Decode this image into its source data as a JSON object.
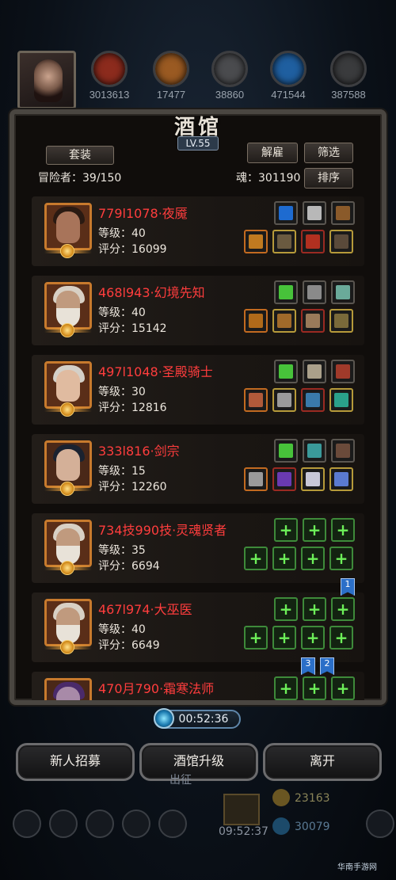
{
  "top_bar": {
    "resources": [
      {
        "value": "3013613",
        "color": "#8c2b1d",
        "icon": "red-orb-icon"
      },
      {
        "value": "17477",
        "color": "#9a5a22",
        "icon": "scroll-orb-icon"
      },
      {
        "value": "38860",
        "color": "#4a4b4e",
        "icon": "ingot-orb-icon"
      },
      {
        "value": "471544",
        "color": "#1f5fa0",
        "icon": "blue-crystal-orb-icon"
      },
      {
        "value": "387588",
        "color": "#3a3b3d",
        "icon": "gray-orb-icon"
      }
    ]
  },
  "panel": {
    "title": "酒馆",
    "level": "LV.55",
    "outfit_button": "套装",
    "dismiss_button": "解雇",
    "filter_button": "筛选",
    "adventurers_label": "冒险者：39/150",
    "soul_label": "魂：301190",
    "sort_button": "排序"
  },
  "heroes": [
    {
      "name": "779l1078·夜魇",
      "level": "等级：40",
      "score": "评分：16099",
      "portrait": "pirate",
      "slots_top": [
        {
          "color": "#1e6bd0",
          "border": "gray"
        },
        {
          "color": "#b8b8b8",
          "border": "gray"
        },
        {
          "color": "#8a5a2a",
          "border": "gray"
        }
      ],
      "slots_bottom": [
        {
          "color": "#c07a20",
          "border": "orange"
        },
        {
          "color": "#6a5a40",
          "border": "gold"
        },
        {
          "color": "#b23020",
          "border": "red"
        },
        {
          "color": "#5a4a3a",
          "border": "gold"
        }
      ]
    },
    {
      "name": "468l943·幻境先知",
      "level": "等级：40",
      "score": "评分：15142",
      "portrait": "sage",
      "slots_top": [
        {
          "color": "#47c23a",
          "border": "gray"
        },
        {
          "color": "#8a8a8a",
          "border": "gray"
        },
        {
          "color": "#6aaa9a",
          "border": "gray"
        }
      ],
      "slots_bottom": [
        {
          "color": "#b06a1a",
          "border": "orange"
        },
        {
          "color": "#a06a2a",
          "border": "gold"
        },
        {
          "color": "#9a7a5a",
          "border": "red"
        },
        {
          "color": "#7a6a3a",
          "border": "gold"
        }
      ]
    },
    {
      "name": "497l1048·圣殿骑士",
      "level": "等级：30",
      "score": "评分：12816",
      "portrait": "knight",
      "slots_top": [
        {
          "color": "#47c23a",
          "border": "gray"
        },
        {
          "color": "#aaa08a",
          "border": "gray"
        },
        {
          "color": "#a03a2a",
          "border": "gray"
        }
      ],
      "slots_bottom": [
        {
          "color": "#b05a3a",
          "border": "orange"
        },
        {
          "color": "#9a9a9a",
          "border": "gold"
        },
        {
          "color": "#3a7aaa",
          "border": "red"
        },
        {
          "color": "#2aa08a",
          "border": "gold"
        }
      ]
    },
    {
      "name": "333l816·剑宗",
      "level": "等级：15",
      "score": "评分：12260",
      "portrait": "swordsman",
      "slots_top": [
        {
          "color": "#47c23a",
          "border": "gray"
        },
        {
          "color": "#3a9a9a",
          "border": "gray"
        },
        {
          "color": "#6a4a3a",
          "border": "gray"
        }
      ],
      "slots_bottom": [
        {
          "color": "#9a9a9a",
          "border": "orange"
        },
        {
          "color": "#6a3ab0",
          "border": "red"
        },
        {
          "color": "#c8c8d8",
          "border": "gold"
        },
        {
          "color": "#5a7ad0",
          "border": "gold"
        }
      ]
    },
    {
      "name": "734技990技·灵魂贤者",
      "level": "等级：35",
      "score": "评分：6694",
      "portrait": "sage",
      "slots_top": [
        {
          "color": "",
          "border": "green"
        },
        {
          "color": "",
          "border": "green"
        },
        {
          "color": "",
          "border": "green"
        }
      ],
      "slots_bottom": [
        {
          "color": "",
          "border": "green"
        },
        {
          "color": "",
          "border": "green"
        },
        {
          "color": "",
          "border": "green"
        },
        {
          "color": "",
          "border": "green"
        }
      ]
    },
    {
      "name": "467l974·大巫医",
      "level": "等级：40",
      "score": "评分：6649",
      "portrait": "sage",
      "slots_top": [
        {
          "color": "",
          "border": "green"
        },
        {
          "color": "",
          "border": "green"
        },
        {
          "color": "",
          "border": "green"
        }
      ],
      "slots_bottom": [
        {
          "color": "",
          "border": "green"
        },
        {
          "color": "",
          "border": "green"
        },
        {
          "color": "",
          "border": "green"
        },
        {
          "color": "",
          "border": "green"
        }
      ]
    },
    {
      "name": "470月790·霜寒法师",
      "level": "",
      "score": "",
      "portrait": "mage",
      "slots_top": [
        {
          "color": "",
          "border": "green"
        },
        {
          "color": "",
          "border": "green"
        },
        {
          "color": "",
          "border": "green"
        }
      ],
      "slots_bottom": []
    }
  ],
  "flags": [
    "1",
    "3",
    "2"
  ],
  "timer": "00:52:36",
  "buttons": {
    "recruit": "新人招募",
    "upgrade": "酒馆升级",
    "leave": "离开"
  },
  "background": {
    "depart_text": "出征",
    "gold_value": "23163",
    "crystal_value": "30079",
    "bottom_timer": "09:52:37"
  },
  "watermark": "华南手游网"
}
